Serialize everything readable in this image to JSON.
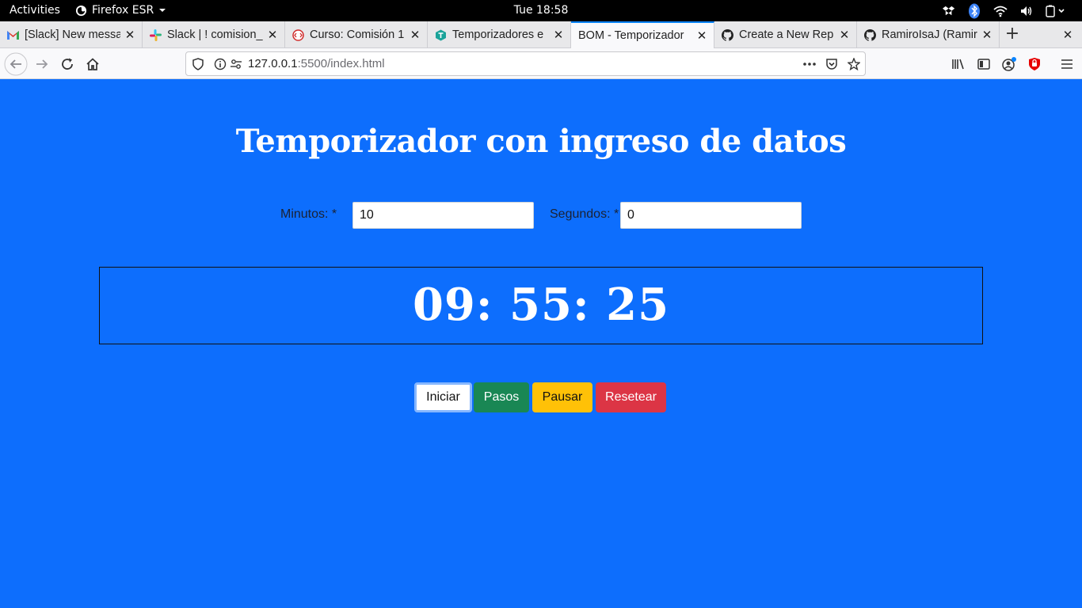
{
  "system": {
    "activities": "Activities",
    "app_name": "Firefox ESR",
    "clock": "Tue 18:58"
  },
  "tabs": [
    {
      "title": "[Slack] New messa",
      "icon": "gmail-icon",
      "active": false
    },
    {
      "title": "Slack | ! comision_",
      "icon": "slack-icon",
      "active": false
    },
    {
      "title": "Curso: Comisión 1",
      "icon": "course-icon",
      "active": false
    },
    {
      "title": "Temporizadores e",
      "icon": "teal-icon",
      "active": false
    },
    {
      "title": "BOM - Temporizador",
      "icon": "none",
      "active": true
    },
    {
      "title": "Create a New Rep",
      "icon": "github-icon",
      "active": false
    },
    {
      "title": "RamiroIsaJ (Ramir",
      "icon": "github-icon",
      "active": false
    }
  ],
  "navbar": {
    "url_host": "127.0.0.1",
    "url_rest": ":5500/index.html"
  },
  "page": {
    "title": "Temporizador con ingreso de datos",
    "minutes_label": "Minutos: *",
    "minutes_value": "10",
    "seconds_label": "Segundos: *",
    "seconds_value": "0",
    "timer": "09: 55: 25",
    "buttons": {
      "start": "Iniciar",
      "steps": "Pasos",
      "pause": "Pausar",
      "reset": "Resetear"
    }
  },
  "colors": {
    "page_background": "#0d6efd",
    "steps_button": "#198754",
    "pause_button": "#ffc107",
    "reset_button": "#dc3545"
  }
}
